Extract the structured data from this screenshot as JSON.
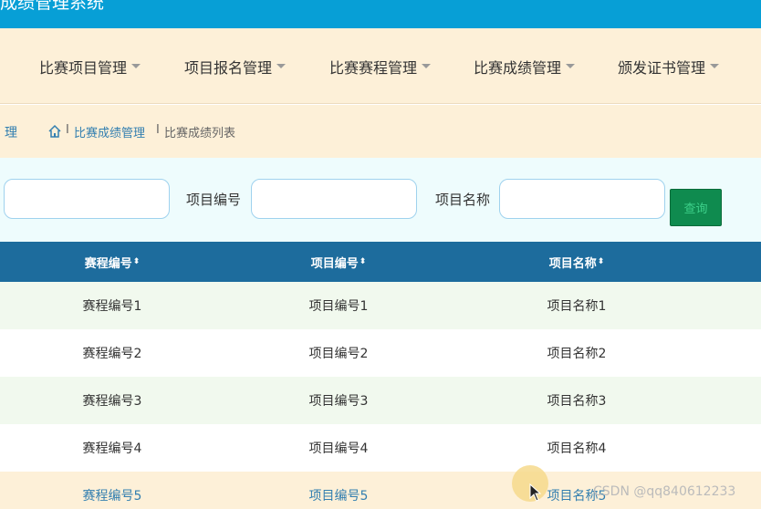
{
  "header": {
    "title": "成绩管理系统"
  },
  "nav": {
    "items": [
      {
        "label": "比赛项目管理"
      },
      {
        "label": "项目报名管理"
      },
      {
        "label": "比赛赛程管理"
      },
      {
        "label": "比赛成绩管理"
      },
      {
        "label": "颁发证书管理"
      }
    ]
  },
  "breadcrumb": {
    "left_text": "理",
    "section": "比赛成绩管理",
    "separator": "I",
    "current": "比赛成绩列表"
  },
  "search": {
    "field1": {
      "value": "",
      "placeholder": ""
    },
    "field2": {
      "label": "项目编号",
      "value": "",
      "placeholder": ""
    },
    "field3": {
      "label": "项目名称",
      "value": "",
      "placeholder": ""
    },
    "button_label": "查询"
  },
  "table": {
    "sort_icon": "⬍",
    "columns": [
      "赛程编号",
      "项目编号",
      "项目名称"
    ],
    "rows": [
      {
        "c1": "赛程编号1",
        "c2": "项目编号1",
        "c3": "项目名称1"
      },
      {
        "c1": "赛程编号2",
        "c2": "项目编号2",
        "c3": "项目名称2"
      },
      {
        "c1": "赛程编号3",
        "c2": "项目编号3",
        "c3": "项目名称3"
      },
      {
        "c1": "赛程编号4",
        "c2": "项目编号4",
        "c3": "项目名称4"
      },
      {
        "c1": "赛程编号5",
        "c2": "项目编号5",
        "c3": "项目名称5"
      }
    ]
  },
  "watermark": "CSDN @qq840612233",
  "colors": {
    "topbar": "#079fd6",
    "nav_bg": "#fdf0d8",
    "table_header": "#1d6c9d",
    "row_alt": "#f1f9ee",
    "search_button": "#0f8b4f",
    "link": "#337fb0"
  },
  "icons": {
    "home": "home-icon",
    "caret": "caret-down-icon",
    "sort": "sort-icon",
    "cursor": "cursor-icon"
  }
}
